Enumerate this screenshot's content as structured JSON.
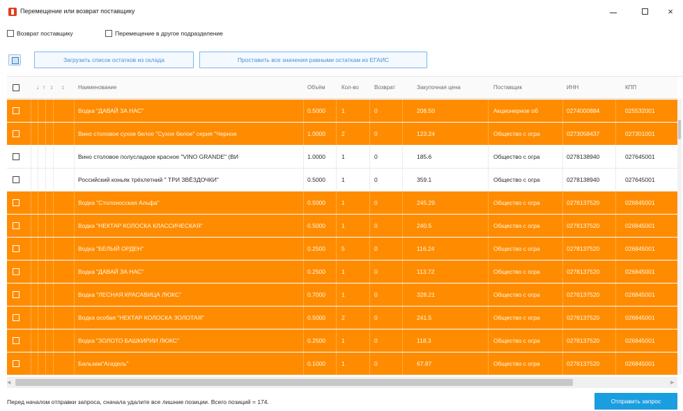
{
  "window": {
    "title": "Перемещение или возврат поставщику",
    "minimize_label": "",
    "maximize_label": "",
    "close_label": "×"
  },
  "options": {
    "return_label": "Возврат поставщику",
    "transfer_label": "Перемещение в другое подразделение"
  },
  "toolbar": {
    "load_label": "Загрузить список остатков из склада",
    "fill_label": "Проставить все значения равными остаткам из ЕГАИС"
  },
  "table": {
    "headers": {
      "h1": "↓",
      "h2": "↑",
      "h3": "↕",
      "h4": "↕",
      "name": "Наименование",
      "vol": "Объём",
      "qty": "Кол-во",
      "ret": "Возврат",
      "price": "Закупочная цена",
      "sup": "Поставщик",
      "inn": "ИНН",
      "kpp": "КПП"
    },
    "rows": [
      {
        "highlight": true,
        "name": "Водка \"ДАВАЙ ЗА НАС\"",
        "vol": "0.5000",
        "qty": "1",
        "ret": "0",
        "price": "208.50",
        "sup": "Акционерное об",
        "inn": "0274000884",
        "kpp": "025532001"
      },
      {
        "highlight": true,
        "name": "Вино столовое сухое белое \"Сухое белое\" серия \"Черное",
        "vol": "1.0000",
        "qty": "2",
        "ret": "0",
        "price": "123.24",
        "sup": "Общество с огра",
        "inn": "0273058437",
        "kpp": "027301001"
      },
      {
        "highlight": false,
        "name": "Вино столовое полусладкое красное \"VINO GRANDE\" (ВИ",
        "vol": "1.0000",
        "qty": "1",
        "ret": "0",
        "price": "185.6",
        "sup": "Общество с огра",
        "inn": "0278138940",
        "kpp": "027645001"
      },
      {
        "highlight": false,
        "name": "Российский коньяк трёхлетний \" ТРИ ЗВЁЗДОЧКИ\"",
        "vol": "0.5000",
        "qty": "1",
        "ret": "0",
        "price": "359.1",
        "sup": "Общество с огра",
        "inn": "0278138940",
        "kpp": "027645001"
      },
      {
        "highlight": true,
        "name": "Водка \"Столоносская Альфа\"",
        "vol": "0.5000",
        "qty": "1",
        "ret": "0",
        "price": "245.29",
        "sup": "Общество с огра",
        "inn": "0278137520",
        "kpp": "026845001"
      },
      {
        "highlight": true,
        "name": "Водка \"НЕКТАР КОЛОСКА КЛАССИЧЕСКАЯ\"",
        "vol": "0.5000",
        "qty": "1",
        "ret": "0",
        "price": "240.5",
        "sup": "Общество с огра",
        "inn": "0278137520",
        "kpp": "026845001"
      },
      {
        "highlight": true,
        "name": "Водка \"БЕЛЫЙ ОРДЕН\"",
        "vol": "0.2500",
        "qty": "5",
        "ret": "0",
        "price": "116.24",
        "sup": "Общество с огра",
        "inn": "0278137520",
        "kpp": "026845001"
      },
      {
        "highlight": true,
        "name": "Водка \"ДАВАЙ ЗА НАС\"",
        "vol": "0.2500",
        "qty": "1",
        "ret": "0",
        "price": "113.72",
        "sup": "Общество с огра",
        "inn": "0278137520",
        "kpp": "026845001"
      },
      {
        "highlight": true,
        "name": "Водка \"ЛЕСНАЯ КРАСАВИЦА ЛЮКС\"",
        "vol": "0.7000",
        "qty": "1",
        "ret": "0",
        "price": "328.21",
        "sup": "Общество с огра",
        "inn": "0278137520",
        "kpp": "026845001"
      },
      {
        "highlight": true,
        "name": "Водка особая \"НЕКТАР КОЛОСКА ЗОЛОТАЯ\"",
        "vol": "0.5000",
        "qty": "2",
        "ret": "0",
        "price": "241.5",
        "sup": "Общество с огра",
        "inn": "0278137520",
        "kpp": "026845001"
      },
      {
        "highlight": true,
        "name": "Водка \"ЗОЛОТО БАШКИРИИ ЛЮКС\"",
        "vol": "0.2500",
        "qty": "1",
        "ret": "0",
        "price": "118.3",
        "sup": "Общество с огра",
        "inn": "0278137520",
        "kpp": "026845001"
      },
      {
        "highlight": true,
        "name": "Бальзам\"Агидель\"",
        "vol": "0.1000",
        "qty": "1",
        "ret": "0",
        "price": "67.87",
        "sup": "Общество с огра",
        "inn": "0278137520",
        "kpp": "026845001"
      }
    ]
  },
  "status": {
    "text": "Перед началом отправки запроса, сначала удалите все лишние позиции. Всего позиций = 174."
  },
  "send_button": {
    "label": "Отправить запрос"
  },
  "colors": {
    "row_highlight": "#ff8c00",
    "accent": "#1a9ee0",
    "toolbar_border": "#79b7ee"
  }
}
